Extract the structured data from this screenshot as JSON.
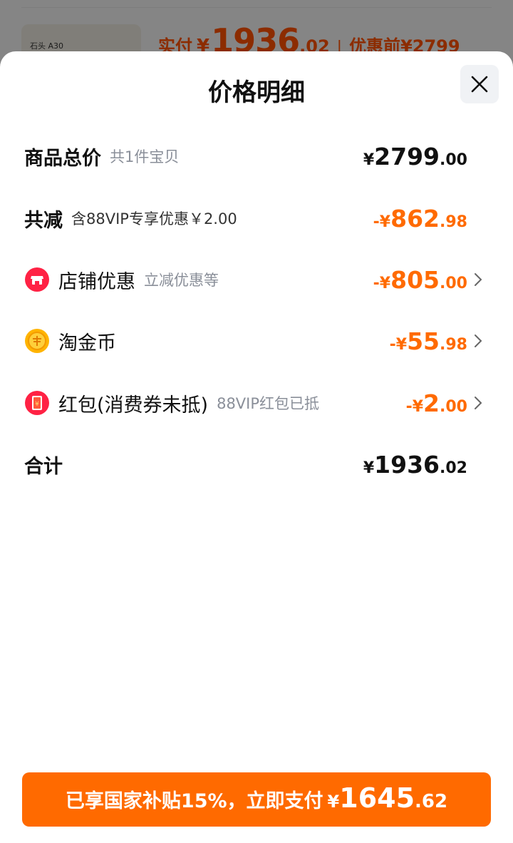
{
  "background": {
    "thumb_label": "石头 A30",
    "price_label": "实付",
    "currency": "¥",
    "price_int": "1936",
    "price_dec": ".02",
    "separator": "|",
    "orig_label": "优惠前",
    "orig_price": "¥2799"
  },
  "sheet": {
    "title": "价格明细"
  },
  "rows": {
    "total": {
      "label": "商品总价",
      "sub": "共1件宝贝",
      "prefix": "¥",
      "int": "2799",
      "dec": ".00"
    },
    "discount": {
      "label": "共减",
      "sub": "含88VIP专享优惠￥2.00",
      "prefix": "-¥",
      "int": "862",
      "dec": ".98"
    },
    "shop": {
      "label": "店铺优惠",
      "sub": "立减优惠等",
      "prefix": "-¥",
      "int": "805",
      "dec": ".00"
    },
    "coins": {
      "label": "淘金币",
      "prefix": "-¥",
      "int": "55",
      "dec": ".98"
    },
    "redpacket": {
      "label": "红包(消费券未抵)",
      "sub": "88VIP红包已抵",
      "prefix": "-¥",
      "int": "2",
      "dec": ".00"
    },
    "sum": {
      "label": "合计",
      "prefix": "¥",
      "int": "1936",
      "dec": ".02"
    }
  },
  "pay_button": {
    "text": "已享国家补贴15%，立即支付",
    "currency": "¥",
    "int": "1645",
    "dec": ".62"
  },
  "colors": {
    "accent": "#ff6a00",
    "text": "#111111",
    "muted": "#8a8f99"
  },
  "icons": {
    "shop": "shop-icon",
    "coin": "coin-icon",
    "redpacket": "red-packet-icon",
    "close": "close-icon",
    "chevron": "chevron-right-icon"
  }
}
